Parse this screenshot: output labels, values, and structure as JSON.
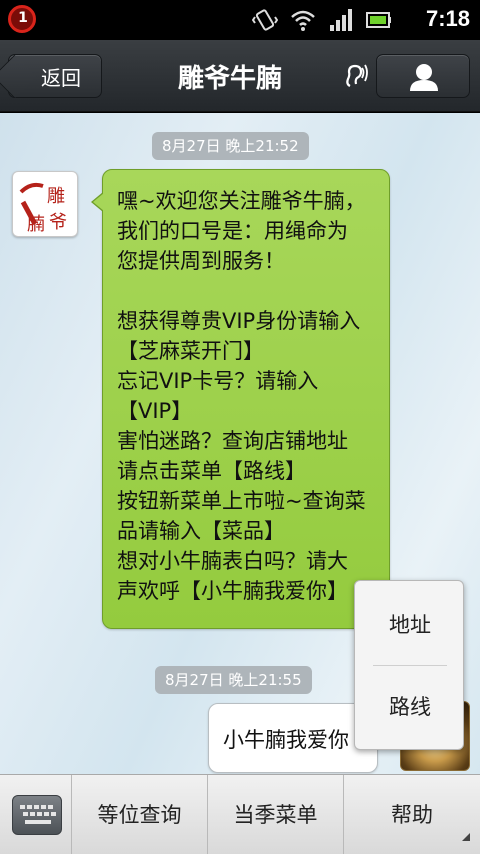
{
  "status_bar": {
    "notification_count": "1",
    "time": "7:18",
    "icons": [
      "vibrate-icon",
      "wifi-icon",
      "signal-icon",
      "battery-icon"
    ]
  },
  "header": {
    "back_label": "返回",
    "title": "雕爷牛腩"
  },
  "chat": {
    "time1": "8月27日 晚上21:52",
    "time2": "8月27日 晚上21:55",
    "left_avatar_text": [
      "雕",
      "腩",
      "爷"
    ],
    "message_lines": [
      "嘿~欢迎您关注雕爷牛腩，",
      "我们的口号是：用绳命为",
      "您提供周到服务！",
      "",
      "想获得尊贵VIP身份请输入",
      "【芝麻菜开门】",
      "忘记VIP卡号？请输入",
      "【VIP】",
      "害怕迷路？查询店铺地址",
      "请点击菜单【路线】",
      "按钮新菜单上市啦~查询菜",
      "品请输入【菜品】",
      "想对小牛腩表白吗？请大",
      "声欢呼【小牛腩我爱你】"
    ],
    "user_message": "小牛腩我爱你"
  },
  "popup_menu": {
    "items": [
      "地址",
      "路线"
    ]
  },
  "bottom_bar": {
    "menus": [
      "等位查询",
      "当季菜单",
      "帮助"
    ]
  },
  "colors": {
    "bubble_green": "#9dd14b",
    "title_bar": "#2e3236",
    "chat_bg": "#dce9f1"
  }
}
